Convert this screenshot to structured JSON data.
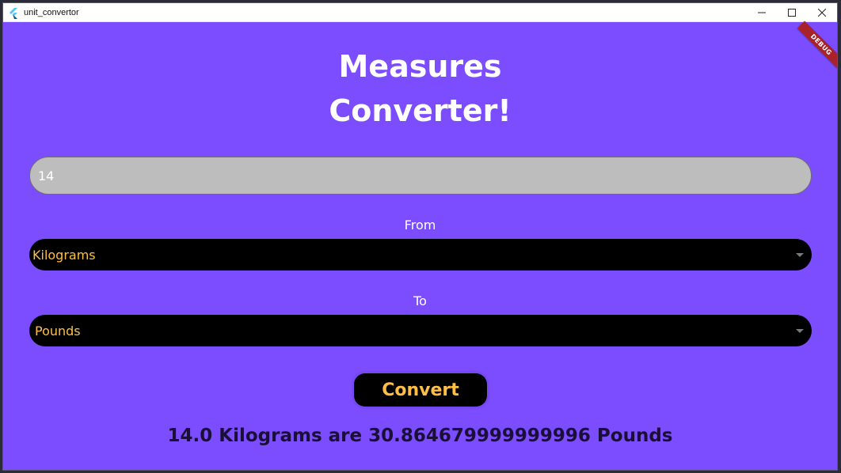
{
  "window": {
    "title": "unit_convertor",
    "debug_banner": "DEBUG"
  },
  "header": {
    "line1": "Measures",
    "line2": "Converter!"
  },
  "input": {
    "value": "14"
  },
  "from": {
    "label": "From",
    "selected": "Kilograms"
  },
  "to": {
    "label": "To",
    "selected": "Pounds"
  },
  "convert_button": {
    "label": "Convert"
  },
  "result": {
    "text": "14.0 Kilograms are 30.864679999999996 Pounds"
  },
  "colors": {
    "background": "#7c4dff",
    "accent_text": "#ffbf47",
    "field": "#bdbdbd",
    "dropdown": "#000000",
    "result_text": "#1a1035"
  },
  "icons": {
    "app": "flutter-icon",
    "minimize": "minimize-icon",
    "maximize": "maximize-icon",
    "close": "close-icon",
    "dropdown": "caret-down-icon"
  }
}
